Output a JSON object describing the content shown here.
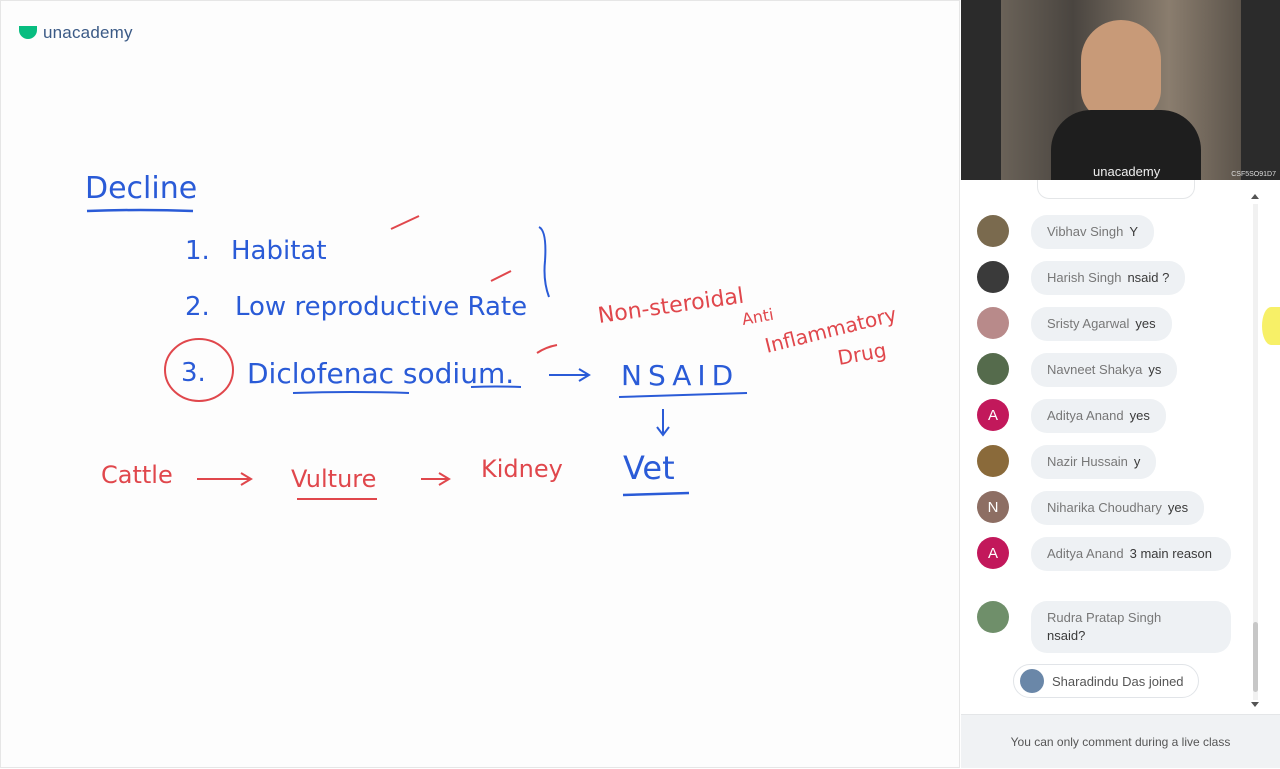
{
  "brand": {
    "name": "unacademy",
    "color": "#08bd80"
  },
  "board": {
    "heading": "Decline",
    "items": [
      {
        "num": "1.",
        "text": "Habitat"
      },
      {
        "num": "2.",
        "text": "Low reproductive Rate"
      },
      {
        "num": "3.",
        "text": "Diclofenac sodium."
      }
    ],
    "nsaid": "NSAID",
    "nsaid_expansion": [
      "Non-steroidal",
      "Anti",
      "Inflammatory",
      "Drug"
    ],
    "vet": "Vet",
    "chain": [
      "Cattle",
      "Vulture",
      "Kidney"
    ]
  },
  "video": {
    "shirt_text": "unacademy",
    "stream_id": "CSF5SO91D7"
  },
  "chat": {
    "messages": [
      {
        "name": "Vibhav Singh",
        "text": "Y",
        "avatar": "photo",
        "color": "#7a6a4e"
      },
      {
        "name": "Harish Singh",
        "text": "nsaid ?",
        "avatar": "photo",
        "color": "#3a3a3a"
      },
      {
        "name": "Sristy Agarwal",
        "text": "yes",
        "avatar": "photo",
        "color": "#b88a8a"
      },
      {
        "name": "Navneet Shakya",
        "text": "ys",
        "avatar": "photo",
        "color": "#556b4c"
      },
      {
        "name": "Aditya Anand",
        "text": "yes",
        "avatar": "A",
        "color": "#c2185b"
      },
      {
        "name": "Nazir Hussain",
        "text": "y",
        "avatar": "photo",
        "color": "#8a6a3a"
      },
      {
        "name": "Niharika Choudhary",
        "text": "yes",
        "avatar": "N",
        "color": "#8d6e63"
      },
      {
        "name": "Aditya Anand",
        "text": "3 main reason",
        "avatar": "A",
        "color": "#c2185b"
      },
      {
        "name": "Rudra Pratap Singh",
        "text": "nsaid?",
        "avatar": "photo",
        "color": "#6f8f6a"
      }
    ],
    "joined": "Sharadindu Das joined",
    "footer": "You can only comment during a live class"
  }
}
